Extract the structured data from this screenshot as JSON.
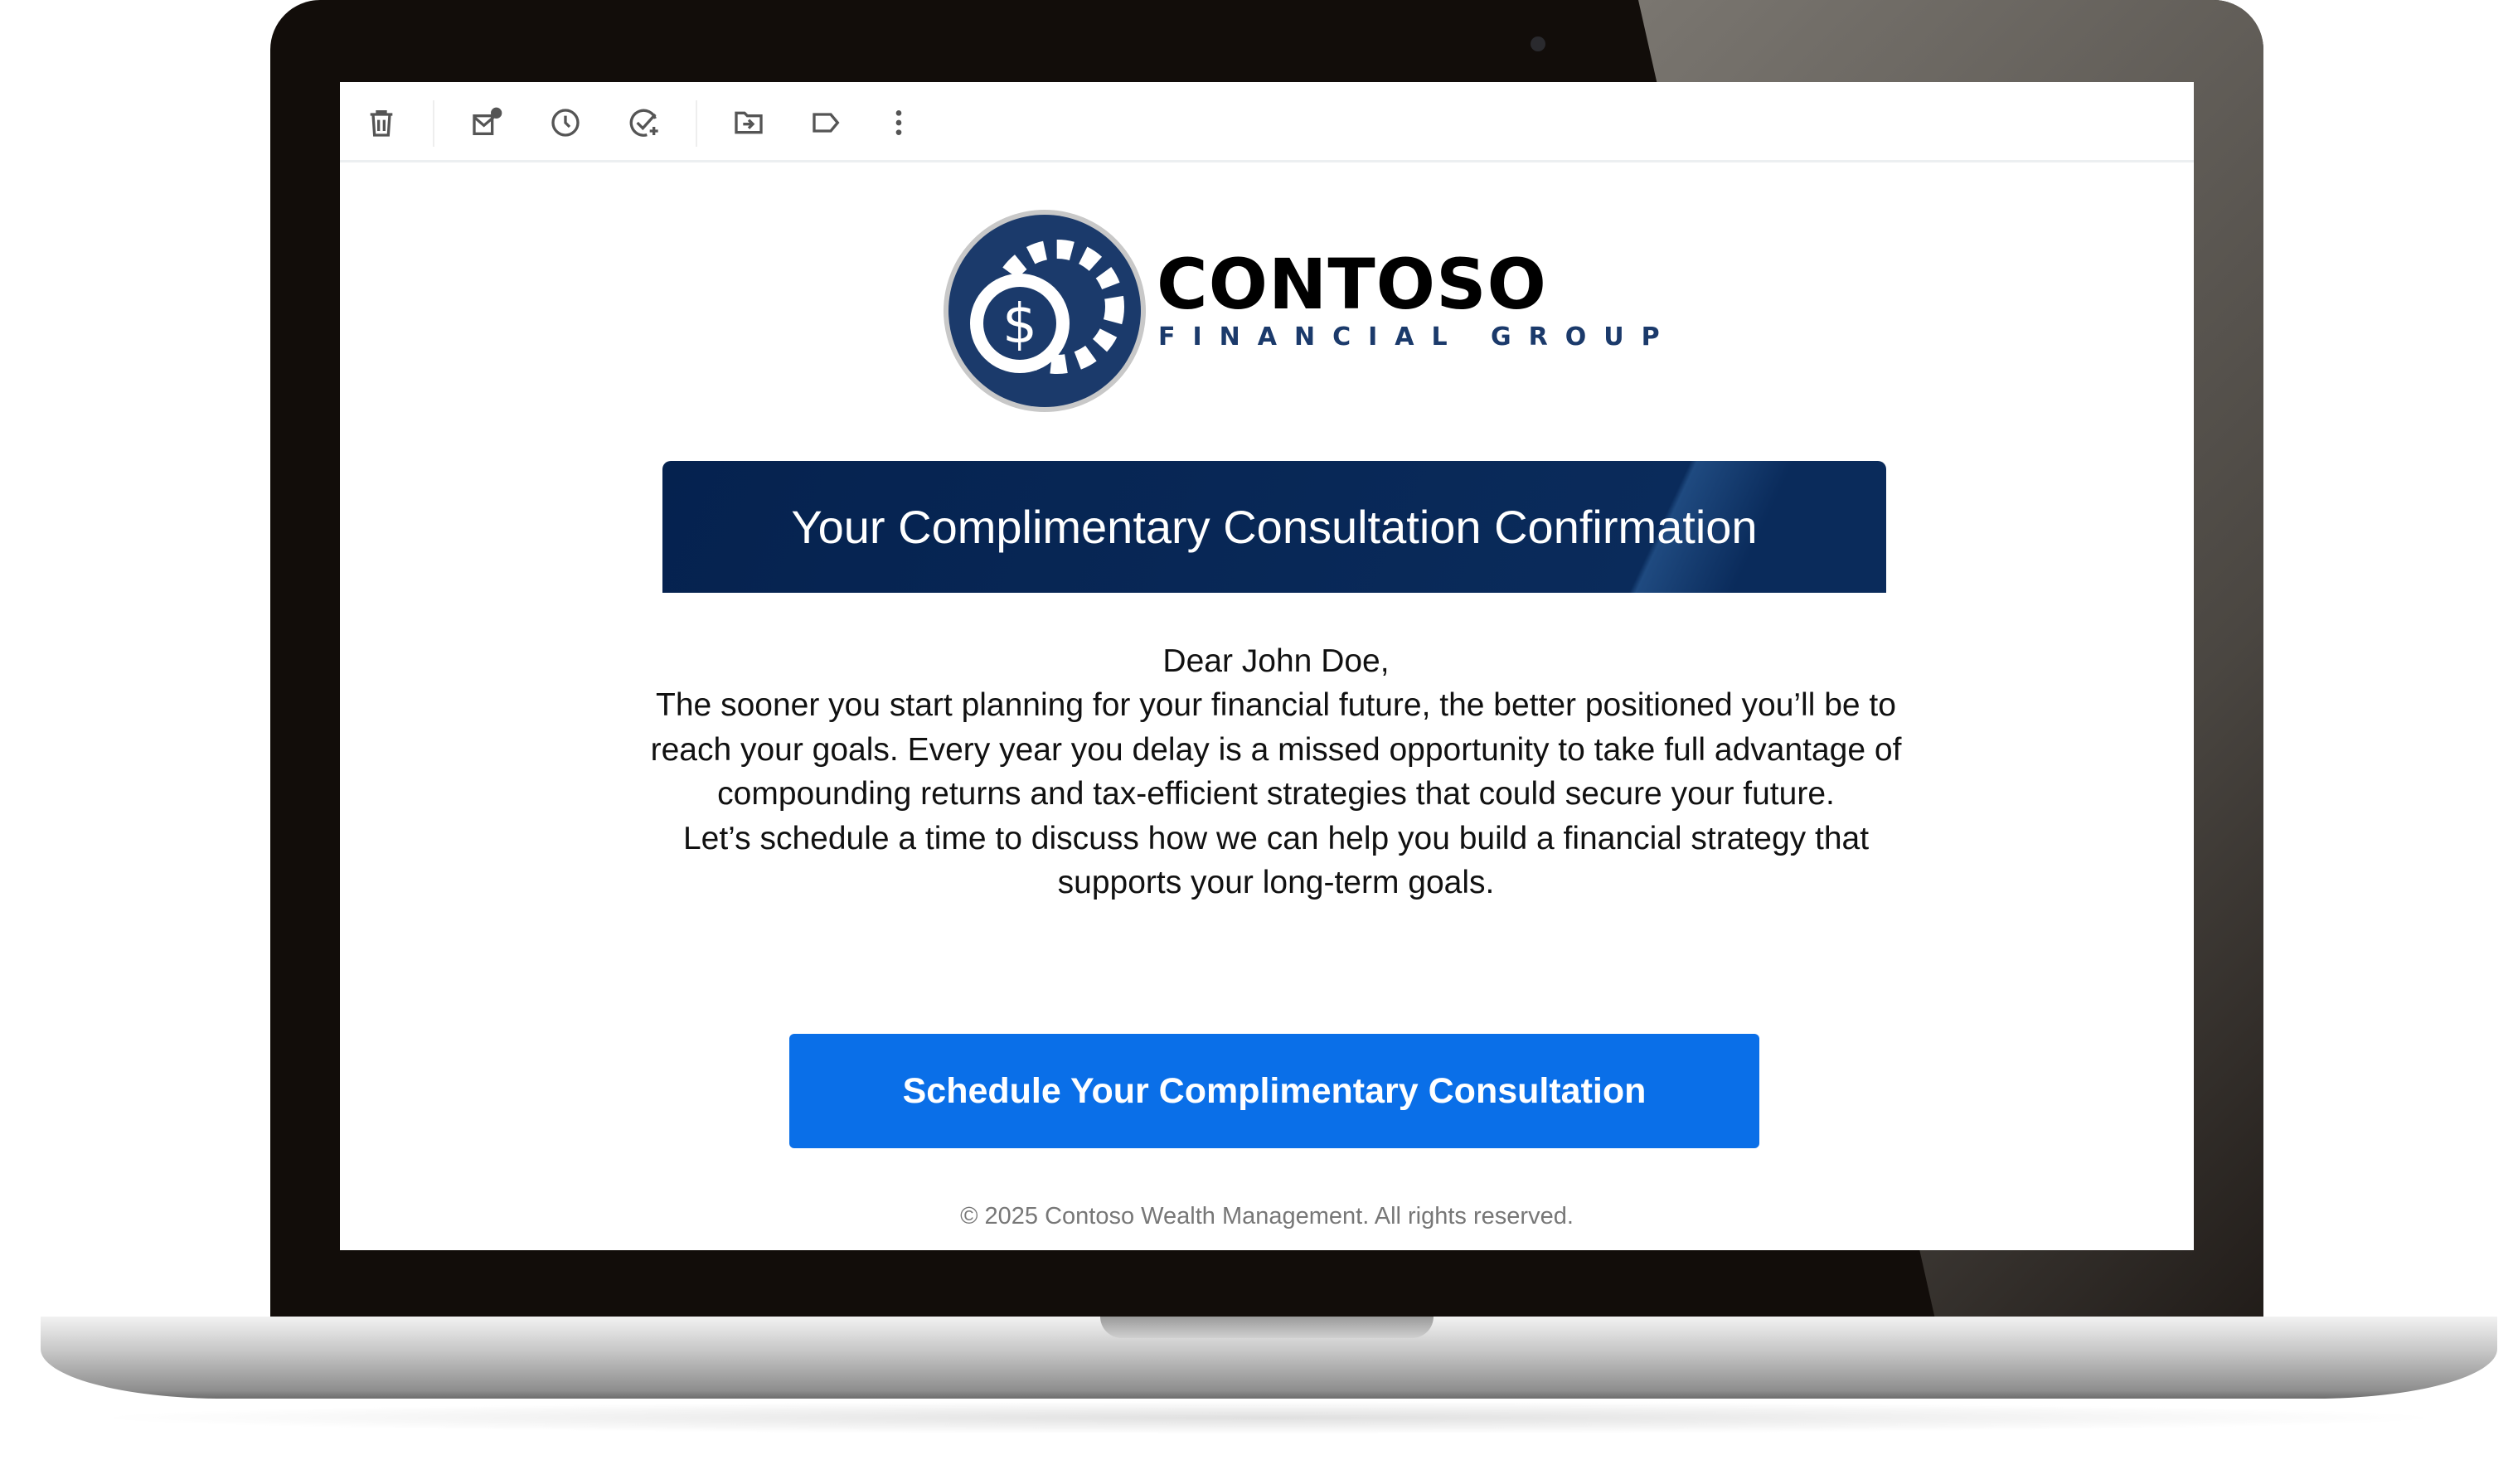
{
  "toolbar": {
    "icons": [
      "trash-icon",
      "mark-unread-icon",
      "snooze-clock-icon",
      "add-task-icon",
      "move-to-folder-icon",
      "label-icon",
      "more-vertical-icon"
    ]
  },
  "logo": {
    "brand": "CONTOSO",
    "tagline": "FINANCIAL GROUP",
    "symbol": "$"
  },
  "email": {
    "banner_title": "Your Complimentary Consultation Confirmation",
    "greeting": "Dear John Doe,",
    "paragraph1": "The sooner you start planning for your financial future, the better positioned you’ll be to reach your goals. Every year you delay is a missed opportunity to take full advantage of compounding returns and tax-efficient strategies that could secure your future.",
    "paragraph2": "Let’s schedule a time to discuss how we can help you build a financial strategy that supports your long-term goals.",
    "cta_label": "Schedule Your Complimentary Consultation",
    "footer": "© 2025 Contoso Wealth Management. All rights reserved."
  },
  "colors": {
    "banner": "#0a2b5b",
    "cta": "#0a6fe8",
    "logo_navy": "#1b3a6b"
  }
}
